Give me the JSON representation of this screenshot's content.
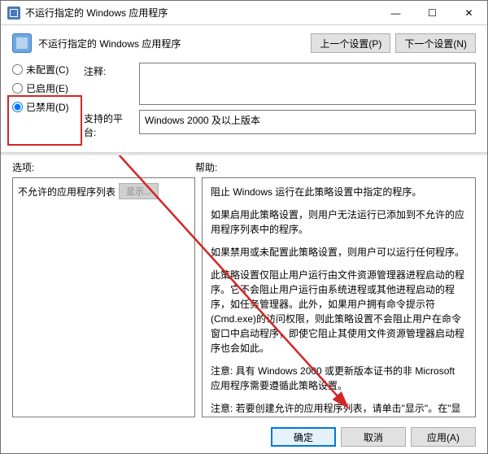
{
  "titlebar": {
    "title": "不运行指定的 Windows 应用程序"
  },
  "header": {
    "policy_name": "不运行指定的 Windows 应用程序",
    "prev_btn": "上一个设置(P)",
    "next_btn": "下一个设置(N)"
  },
  "radios": {
    "not_configured": "未配置(C)",
    "enabled": "已启用(E)",
    "disabled": "已禁用(D)",
    "selected": "disabled"
  },
  "fields": {
    "comment_label": "注释:",
    "comment_value": "",
    "platform_label": "支持的平台:",
    "platform_value": "Windows 2000 及以上版本"
  },
  "lower": {
    "options_label": "选项:",
    "help_label": "帮助:"
  },
  "options": {
    "list_label": "不允许的应用程序列表",
    "show_btn": "显示..."
  },
  "help": {
    "p1": "阻止 Windows 运行在此策略设置中指定的程序。",
    "p2": "如果启用此策略设置，则用户无法运行已添加到不允许的应用程序列表中的程序。",
    "p3": "如果禁用或未配置此策略设置，则用户可以运行任何程序。",
    "p4": "此策略设置仅阻止用户运行由文件资源管理器进程启动的程序。它不会阻止用户运行由系统进程或其他进程启动的程序，如任务管理器。此外，如果用户拥有命令提示符(Cmd.exe)的访问权限，则此策略设置不会阻止用户在命令窗口中启动程序，即使它阻止其使用文件资源管理器启动程序也会如此。",
    "p5": "注意: 具有 Windows 2000 或更新版本证书的非 Microsoft 应用程序需要遵循此策略设置。",
    "p6": "注意: 若要创建允许的应用程序列表，请单击\"显示\"。在\"显示内容\"对话框的\"值\"列中，键入应用程序可执行文件名(例如，Winword.exe、Poledit.exe 和 Powerpnt.exe)。"
  },
  "footer": {
    "ok": "确定",
    "cancel": "取消",
    "apply": "应用(A)"
  }
}
